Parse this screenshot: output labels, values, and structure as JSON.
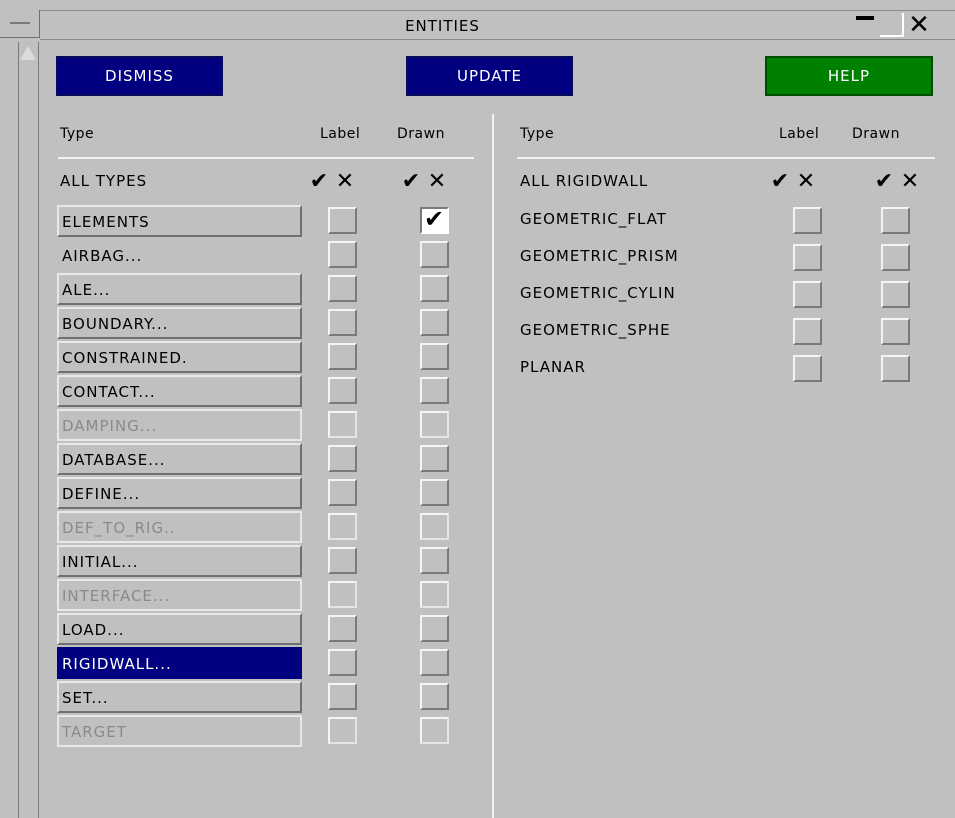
{
  "window": {
    "title": "ENTITIES",
    "minimize_icon": "minimize-icon",
    "maximize_icon": "maximize-icon",
    "close_glyph": "✕"
  },
  "toolbar": {
    "dismiss_label": "DISMISS",
    "update_label": "UPDATE",
    "help_label": "HELP",
    "colors": {
      "dismiss": "#000080",
      "update": "#000080",
      "help": "#008000"
    }
  },
  "left_table": {
    "headers": {
      "type": "Type",
      "label": "Label",
      "drawn": "Drawn"
    },
    "all_row": {
      "label": "ALL TYPES",
      "check": "✔",
      "cross": "✕"
    },
    "rows": [
      {
        "label": "ELEMENTS",
        "state": "button",
        "label_checked": false,
        "drawn_checked": true
      },
      {
        "label": "AIRBAG...",
        "state": "plain",
        "label_checked": false,
        "drawn_checked": false
      },
      {
        "label": "ALE...",
        "state": "button",
        "label_checked": false,
        "drawn_checked": false
      },
      {
        "label": "BOUNDARY...",
        "state": "button",
        "label_checked": false,
        "drawn_checked": false
      },
      {
        "label": "CONSTRAINED.",
        "state": "button",
        "label_checked": false,
        "drawn_checked": false
      },
      {
        "label": "CONTACT...",
        "state": "button",
        "label_checked": false,
        "drawn_checked": false
      },
      {
        "label": "DAMPING...",
        "state": "disabled",
        "label_checked": false,
        "drawn_checked": false
      },
      {
        "label": "DATABASE...",
        "state": "button",
        "label_checked": false,
        "drawn_checked": false
      },
      {
        "label": "DEFINE...",
        "state": "button",
        "label_checked": false,
        "drawn_checked": false
      },
      {
        "label": "DEF_TO_RIG..",
        "state": "disabled",
        "label_checked": false,
        "drawn_checked": false
      },
      {
        "label": "INITIAL...",
        "state": "button",
        "label_checked": false,
        "drawn_checked": false
      },
      {
        "label": "INTERFACE...",
        "state": "disabled",
        "label_checked": false,
        "drawn_checked": false
      },
      {
        "label": "LOAD...",
        "state": "button",
        "label_checked": false,
        "drawn_checked": false
      },
      {
        "label": "RIGIDWALL...",
        "state": "selected",
        "label_checked": false,
        "drawn_checked": false
      },
      {
        "label": "SET...",
        "state": "button",
        "label_checked": false,
        "drawn_checked": false
      },
      {
        "label": "TARGET",
        "state": "disabled",
        "label_checked": false,
        "drawn_checked": false
      }
    ]
  },
  "right_table": {
    "headers": {
      "type": "Type",
      "label": "Label",
      "drawn": "Drawn"
    },
    "all_row": {
      "label": "ALL RIGIDWALL",
      "check": "✔",
      "cross": "✕"
    },
    "rows": [
      {
        "label": "GEOMETRIC_FLAT",
        "label_checked": false,
        "drawn_checked": false
      },
      {
        "label": "GEOMETRIC_PRISM",
        "label_checked": false,
        "drawn_checked": false
      },
      {
        "label": "GEOMETRIC_CYLIN",
        "label_checked": false,
        "drawn_checked": false
      },
      {
        "label": "GEOMETRIC_SPHE",
        "label_checked": false,
        "drawn_checked": false
      },
      {
        "label": "PLANAR",
        "label_checked": false,
        "drawn_checked": false
      }
    ]
  },
  "checkmark_glyph": "✔"
}
